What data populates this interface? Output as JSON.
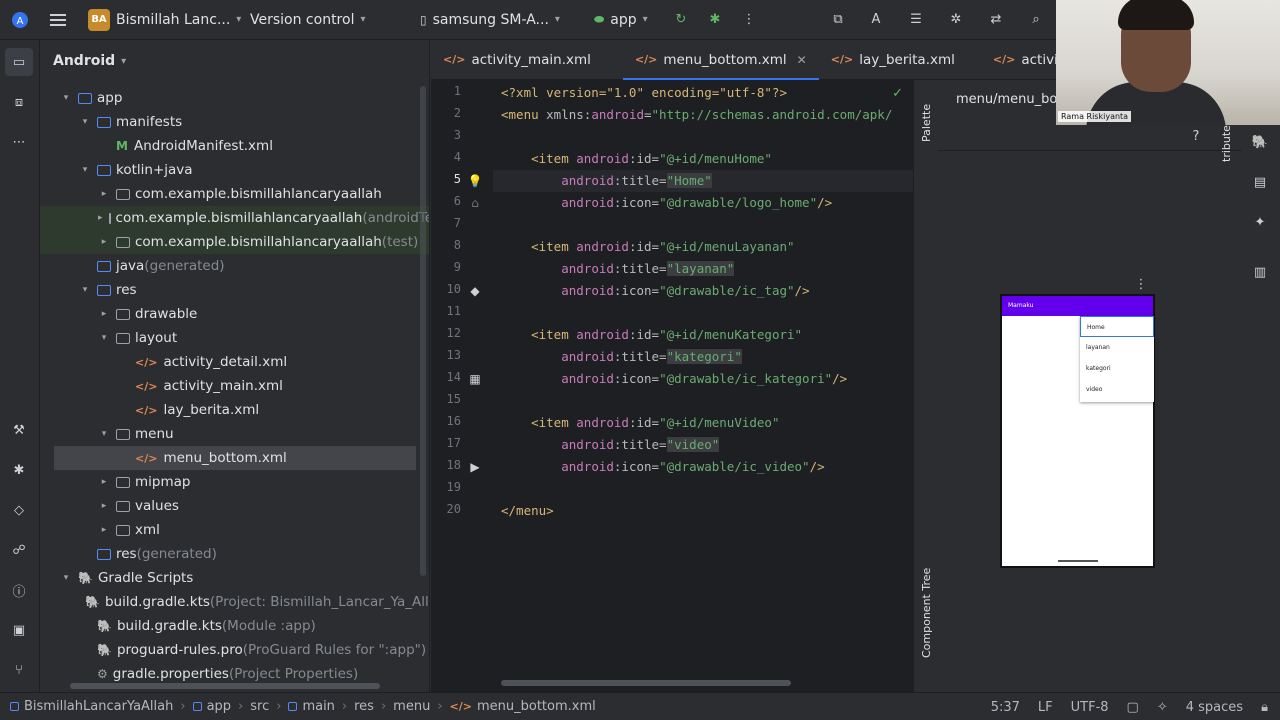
{
  "toolbar": {
    "project_badge": "BA",
    "project_name": "Bismillah Lanc...",
    "vcs_label": "Version control",
    "device": "samsung SM-A...",
    "run_config": "app"
  },
  "project_panel": {
    "view": "Android",
    "tree": [
      {
        "label": "app",
        "extra": "",
        "depth": 0
      },
      {
        "label": "manifests",
        "extra": "",
        "depth": 1
      },
      {
        "label": "AndroidManifest.xml",
        "extra": "",
        "depth": 2
      },
      {
        "label": "kotlin+java",
        "extra": "",
        "depth": 1
      },
      {
        "label": "com.example.bismillahlancaryaallah",
        "extra": "",
        "depth": 2
      },
      {
        "label": "com.example.bismillahlancaryaallah",
        "extra": "(androidTes",
        "depth": 2
      },
      {
        "label": "com.example.bismillahlancaryaallah",
        "extra": "(test)",
        "depth": 2
      },
      {
        "label": "java",
        "extra": "(generated)",
        "depth": 1
      },
      {
        "label": "res",
        "extra": "",
        "depth": 1
      },
      {
        "label": "drawable",
        "extra": "",
        "depth": 2
      },
      {
        "label": "layout",
        "extra": "",
        "depth": 2
      },
      {
        "label": "activity_detail.xml",
        "extra": "",
        "depth": 3
      },
      {
        "label": "activity_main.xml",
        "extra": "",
        "depth": 3
      },
      {
        "label": "lay_berita.xml",
        "extra": "",
        "depth": 3
      },
      {
        "label": "menu",
        "extra": "",
        "depth": 2
      },
      {
        "label": "menu_bottom.xml",
        "extra": "",
        "depth": 3
      },
      {
        "label": "mipmap",
        "extra": "",
        "depth": 2
      },
      {
        "label": "values",
        "extra": "",
        "depth": 2
      },
      {
        "label": "xml",
        "extra": "",
        "depth": 2
      },
      {
        "label": "res",
        "extra": "(generated)",
        "depth": 1
      },
      {
        "label": "Gradle Scripts",
        "extra": "",
        "depth": 0
      },
      {
        "label": "build.gradle.kts",
        "extra": "(Project: Bismillah_Lancar_Ya_Allah)",
        "depth": 1
      },
      {
        "label": "build.gradle.kts",
        "extra": "(Module :app)",
        "depth": 1
      },
      {
        "label": "proguard-rules.pro",
        "extra": "(ProGuard Rules for \":app\")",
        "depth": 1
      },
      {
        "label": "gradle.properties",
        "extra": "(Project Properties)",
        "depth": 1
      }
    ]
  },
  "tabs": [
    {
      "label": "activity_main.xml"
    },
    {
      "label": "menu_bottom.xml"
    },
    {
      "label": "lay_berita.xml"
    },
    {
      "label": "activity_detail.xm"
    }
  ],
  "editor": {
    "line_numbers": [
      "1",
      "2",
      "3",
      "4",
      "5",
      "6",
      "7",
      "8",
      "9",
      "10",
      "11",
      "12",
      "13",
      "14",
      "15",
      "16",
      "17",
      "18",
      "19",
      "20"
    ],
    "lines": {
      "l1": "<?xml version=\"1.0\" encoding=\"utf-8\"?>",
      "l2a": "<menu ",
      "l2b": "xmlns:",
      "l2c": "android",
      "l2d": "=",
      "l2e": "\"http://schemas.android.com/apk/",
      "item_open": "<item ",
      "android": "android",
      "id_attr": ":id=",
      "title_attr": ":title=",
      "icon_attr": ":icon=",
      "close_tag": "/>",
      "id1": "\"@+id/menuHome\"",
      "title1": "\"Home\"",
      "icon1": "\"@drawable/logo_home\"",
      "id2": "\"@+id/menuLayanan\"",
      "title2": "\"layanan\"",
      "icon2": "\"@drawable/ic_tag\"",
      "id3": "\"@+id/menuKategori\"",
      "title3": "\"kategori\"",
      "icon3": "\"@drawable/ic_kategori\"",
      "id4": "\"@+id/menuVideo\"",
      "title4": "\"video\"",
      "icon4": "\"@drawable/ic_video\"",
      "l20": "</menu>"
    }
  },
  "design": {
    "title": "menu/menu_bott",
    "palette_label": "Palette",
    "tree_label": "Component Tree",
    "attrs_label": "tributes",
    "app_bar_title": "Mamaku",
    "menu_items": [
      "Home",
      "layanan",
      "kategori",
      "video"
    ]
  },
  "webcam": {
    "name": "Rama Riskiyanta"
  },
  "status": {
    "breadcrumbs": [
      "BismillahLancarYaAllah",
      "app",
      "src",
      "main",
      "res",
      "menu",
      "menu_bottom.xml"
    ],
    "position": "5:37",
    "line_sep": "LF",
    "encoding": "UTF-8",
    "indent": "4 spaces"
  },
  "colors": {
    "accent": "#3574f0",
    "app_bar": "#6200ee"
  }
}
